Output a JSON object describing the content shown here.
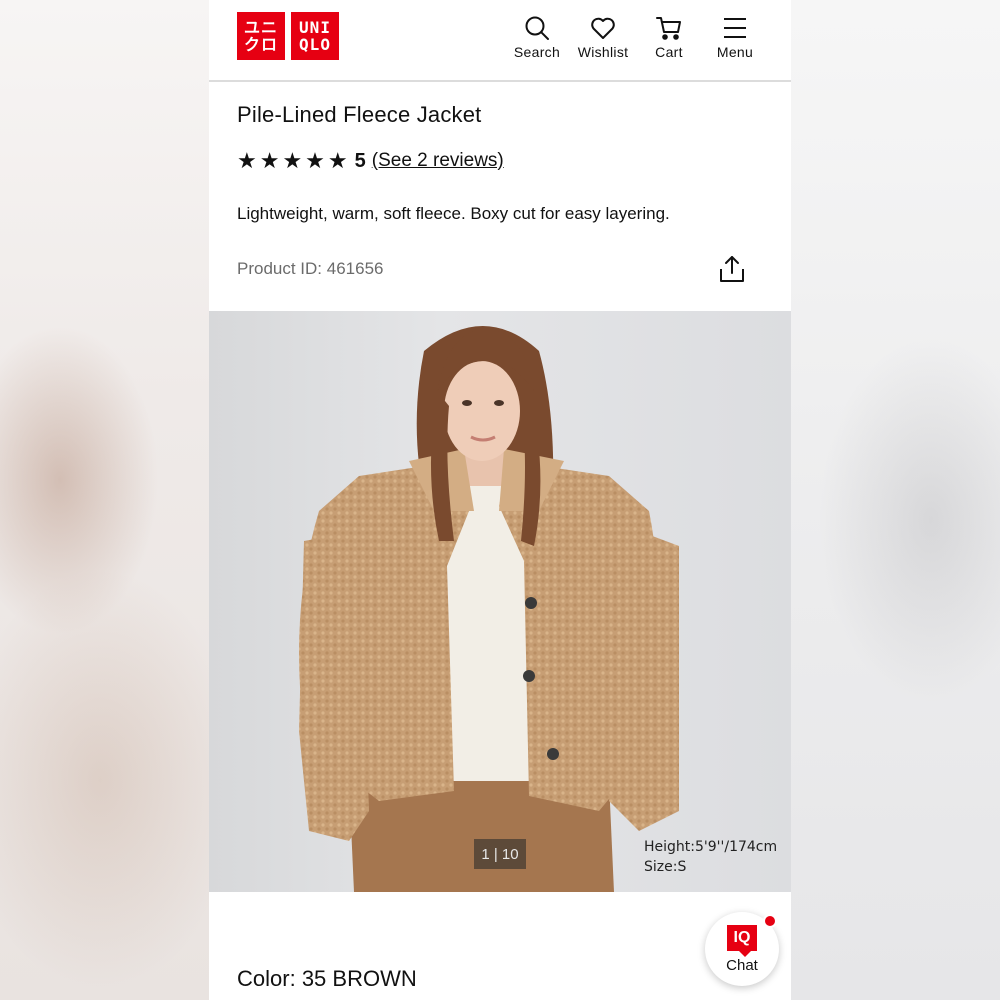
{
  "header": {
    "logo_katakana": [
      "ユニ",
      "クロ"
    ],
    "logo_latin": [
      "UNI",
      "QLO"
    ],
    "nav": [
      {
        "label": "Search",
        "icon": "search-icon"
      },
      {
        "label": "Wishlist",
        "icon": "heart-icon"
      },
      {
        "label": "Cart",
        "icon": "cart-icon"
      },
      {
        "label": "Menu",
        "icon": "hamburger-menu-icon"
      }
    ]
  },
  "product": {
    "title": "Pile-Lined Fleece Jacket",
    "stars": "★★★★★",
    "rating": "5",
    "reviews_label": "(See 2 reviews)",
    "description": "Lightweight, warm, soft fleece. Boxy cut for easy layering.",
    "product_id": "Product ID: 461656",
    "share_icon": "share-icon"
  },
  "gallery": {
    "counter": "1 | 10",
    "model_height": "Height:5'9''/174cm",
    "model_size": "Size:S"
  },
  "color": {
    "label": "Color:",
    "value": "35 BROWN"
  },
  "chat": {
    "badge": "IQ",
    "label": "Chat"
  },
  "colors": {
    "brand_red": "#e60012",
    "jacket_brown": "#c9a37c"
  }
}
